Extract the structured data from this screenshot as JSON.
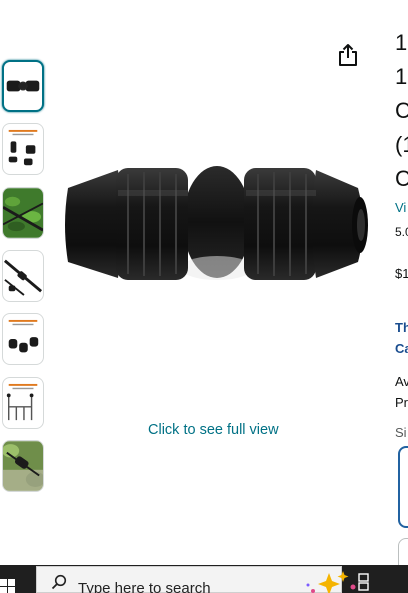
{
  "product": {
    "title_lines": [
      "1",
      "1",
      "C",
      "(1",
      "C"
    ],
    "store_link": "Vi",
    "rating": "5.0",
    "price": "$1",
    "bold_link_lines": [
      "Th",
      "Ca"
    ],
    "availability_lines": [
      "Av",
      "Pr"
    ],
    "size_label": "Si"
  },
  "gallery": {
    "full_view_label": "Click to see full view",
    "thumbnail_count": 7,
    "selected_index": 0
  },
  "taskbar": {
    "search_placeholder": "Type here to search"
  },
  "colors": {
    "link": "#007185",
    "selected_border": "#007185",
    "taskbar": "#1f1f1f"
  }
}
